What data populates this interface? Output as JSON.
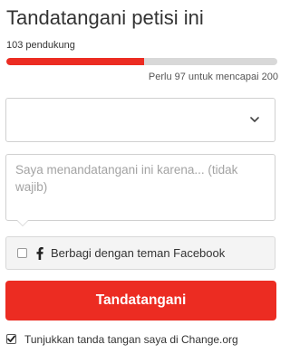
{
  "petition": {
    "title": "Tandatangani petisi ini",
    "supporters_label": "103 pendukung",
    "progress": {
      "fraction": 0.51,
      "color": "#ec2c22",
      "track_color": "#d8d8d8"
    },
    "remaining_label": "Perlu 97 untuk mencapai 200"
  },
  "form": {
    "select": {
      "value": "",
      "icon": "chevron-down-icon"
    },
    "reason": {
      "value": "",
      "placeholder": "Saya menandatangani ini karena... (tidak wajib)"
    },
    "facebook_share": {
      "checked": false,
      "icon": "facebook-icon",
      "label": "Berbagi dengan teman Facebook"
    },
    "sign_button_label": "Tandatangani",
    "sign_button_color": "#ec2c22",
    "show_signature": {
      "checked": true,
      "label": "Tunjukkan tanda tangan saya di Change.org"
    }
  }
}
